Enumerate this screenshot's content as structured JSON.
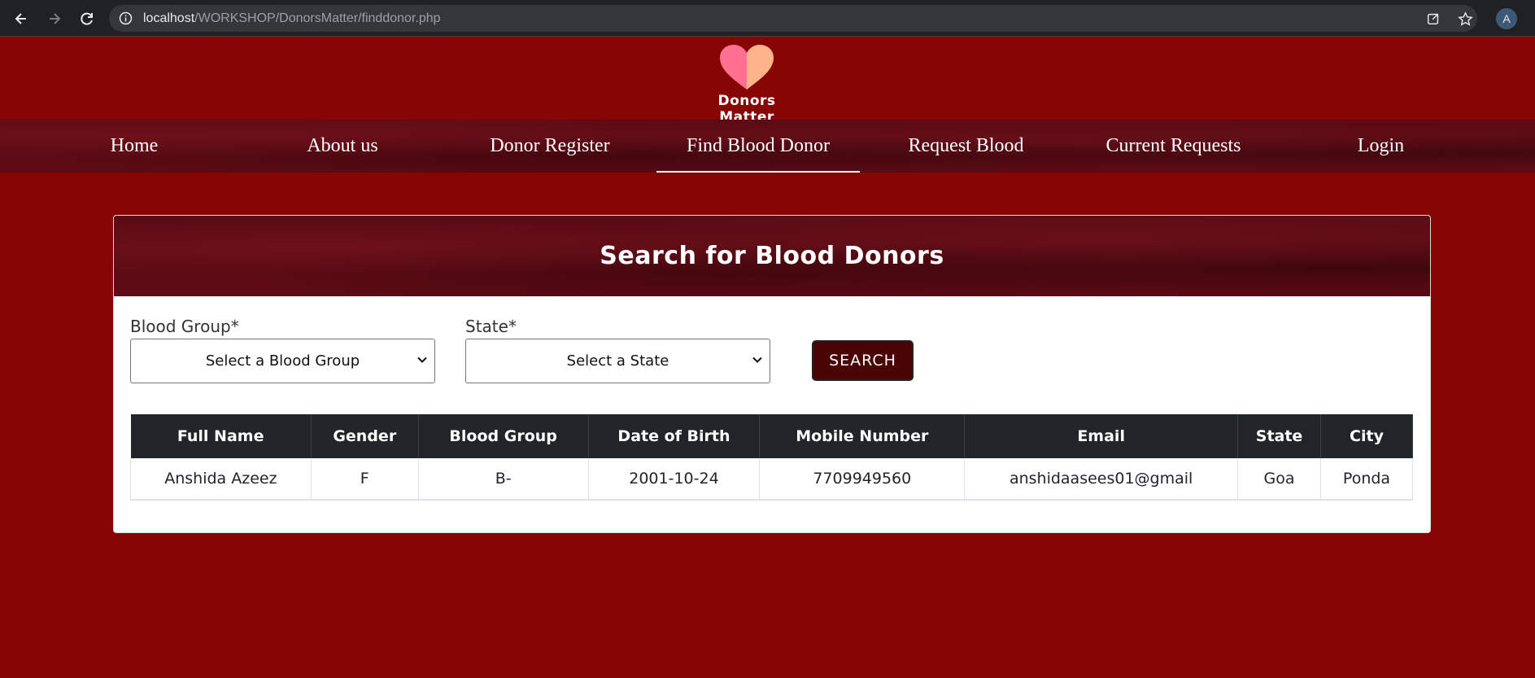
{
  "browser": {
    "url_host": "localhost",
    "url_path": "/WORKSHOP/DonorsMatter/finddonor.php",
    "avatar_letter": "A"
  },
  "brand": {
    "name": "Donors Matter",
    "heart_left_color": "#ff6f91",
    "heart_right_color": "#ffb38a"
  },
  "nav": {
    "items": [
      {
        "label": "Home"
      },
      {
        "label": "About us"
      },
      {
        "label": "Donor Register"
      },
      {
        "label": "Find Blood Donor"
      },
      {
        "label": "Request Blood"
      },
      {
        "label": "Current Requests"
      },
      {
        "label": "Login"
      }
    ],
    "active": "Find Blood Donor"
  },
  "search": {
    "title": "Search for Blood Donors",
    "blood_group_label": "Blood Group*",
    "blood_group_selected": "Select a Blood Group",
    "state_label": "State*",
    "state_selected": "Select a State",
    "button_label": "SEARCH"
  },
  "results": {
    "columns": [
      "Full Name",
      "Gender",
      "Blood Group",
      "Date of Birth",
      "Mobile Number",
      "Email",
      "State",
      "City"
    ],
    "rows": [
      [
        "Anshida Azeez",
        "F",
        "B-",
        "2001-10-24",
        "7709949560",
        "anshidaasees01@gmail",
        "Goa",
        "Ponda"
      ]
    ]
  },
  "colors": {
    "page_bg": "#870505",
    "header_dark": "#212529",
    "button_bg": "#4a0404"
  }
}
